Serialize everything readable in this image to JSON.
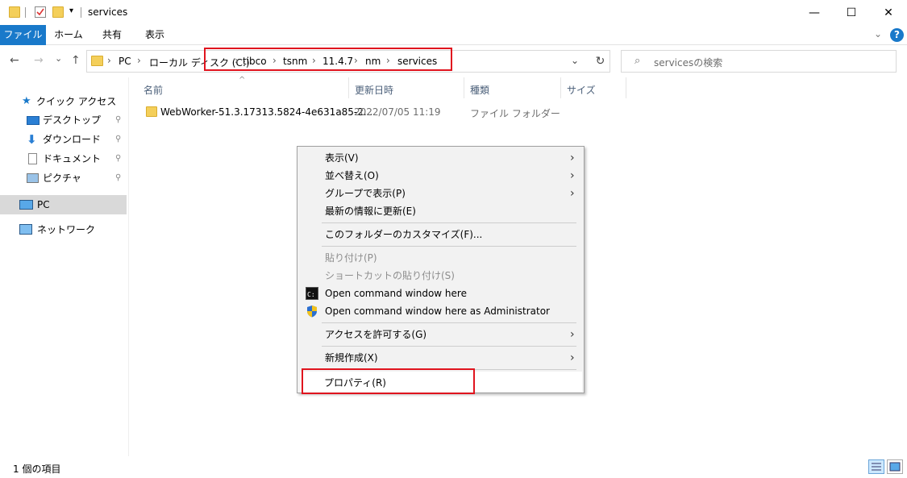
{
  "window": {
    "title": "services",
    "minimize": "—",
    "maximize": "☐",
    "close": "✕"
  },
  "ribbon": {
    "tabs": [
      "ファイル",
      "ホーム",
      "共有",
      "表示"
    ],
    "collapse": "⌄",
    "help": "?"
  },
  "nav": {
    "back": "←",
    "forward": "→",
    "recent": "⌄",
    "up": "↑"
  },
  "address": {
    "breadcrumbs": [
      "PC",
      "ローカル ディスク (C:)",
      "tibco",
      "tsnm",
      "11.4.7",
      "nm",
      "services"
    ],
    "separator": "›",
    "dropdown": "⌄",
    "refresh": "↻"
  },
  "search": {
    "placeholder": "servicesの検索",
    "icon": "⌕"
  },
  "sidebar": {
    "items": [
      {
        "label": "クイック アクセス",
        "icon": "star-icon",
        "pinned": false
      },
      {
        "label": "デスクトップ",
        "icon": "desktop-icon",
        "pinned": true
      },
      {
        "label": "ダウンロード",
        "icon": "download-icon",
        "pinned": true
      },
      {
        "label": "ドキュメント",
        "icon": "document-icon",
        "pinned": true
      },
      {
        "label": "ピクチャ",
        "icon": "picture-icon",
        "pinned": true
      },
      {
        "label": "PC",
        "icon": "pc-icon",
        "pinned": false,
        "selected": true
      },
      {
        "label": "ネットワーク",
        "icon": "network-icon",
        "pinned": false
      }
    ],
    "pin_glyph": "📌"
  },
  "filelist": {
    "columns": [
      "名前",
      "更新日時",
      "種類",
      "サイズ"
    ],
    "sort_caret": "^",
    "rows": [
      {
        "name": "WebWorker-51.3.17313.5824-4e631a85-2...",
        "modified": "2022/07/05 11:19",
        "type": "ファイル フォルダー",
        "size": ""
      }
    ]
  },
  "context_menu": {
    "items": [
      {
        "label": "表示(V)",
        "submenu": true
      },
      {
        "label": "並べ替え(O)",
        "submenu": true
      },
      {
        "label": "グループで表示(P)",
        "submenu": true
      },
      {
        "label": "最新の情報に更新(E)",
        "submenu": false
      },
      {
        "label": "このフォルダーのカスタマイズ(F)...",
        "submenu": false
      },
      {
        "label": "貼り付け(P)",
        "disabled": true
      },
      {
        "label": "ショートカットの貼り付け(S)",
        "disabled": true
      },
      {
        "label": "Open command window here",
        "icon": "cmd-icon"
      },
      {
        "label": "Open command window here as Administrator",
        "icon": "uac-shield-icon"
      },
      {
        "label": "アクセスを許可する(G)",
        "submenu": true
      },
      {
        "label": "新規作成(X)",
        "submenu": true
      },
      {
        "label": "プロパティ(R)",
        "submenu": false,
        "highlighted": true
      }
    ],
    "arrow": "›"
  },
  "status": {
    "item_count": "1 個の項目"
  },
  "colors": {
    "accent": "#1979ca",
    "highlight_box": "#e0141e",
    "folder": "#f4cf5a"
  }
}
